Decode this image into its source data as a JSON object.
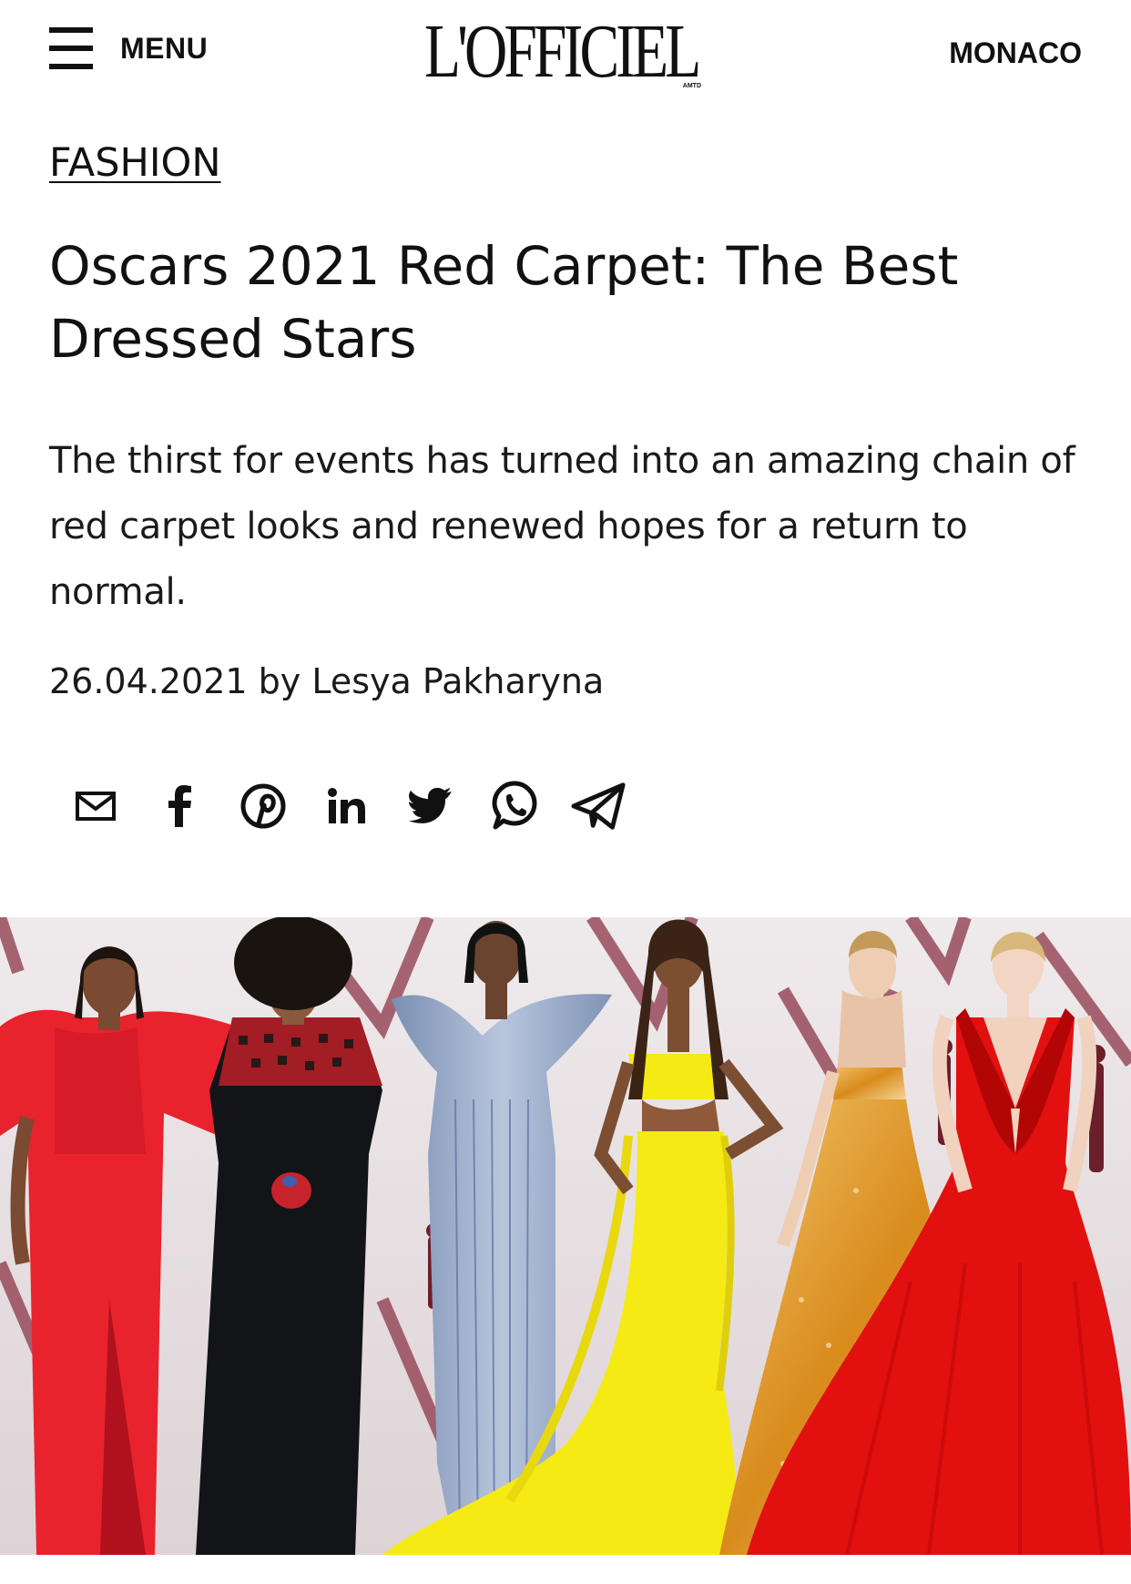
{
  "header": {
    "menu_label": "MENU",
    "logo_text": "L'OFFICIEL",
    "logo_sub": "AMTD",
    "region_label": "MONACO"
  },
  "article": {
    "category": "FASHION",
    "title": "Oscars 2021 Red Carpet: The Best Dressed Stars",
    "subtitle": "The thirst for events has turned into an amazing chain of red carpet looks and renewed hopes for a return to normal.",
    "meta": "26.04.2021 by Lesya Pakharyna"
  },
  "share_icons": [
    "email-icon",
    "facebook-icon",
    "pinterest-icon",
    "linkedin-icon",
    "twitter-icon",
    "whatsapp-icon",
    "telegram-icon"
  ],
  "hero_image": {
    "content": "collage of six women in gowns on the Oscars red carpet",
    "dress_colors": [
      "#e8232e",
      "#121418",
      "#8fa4c4",
      "#f5ea14",
      "#e6a334",
      "#e2100f"
    ],
    "background_color": "#e7e1e3"
  }
}
